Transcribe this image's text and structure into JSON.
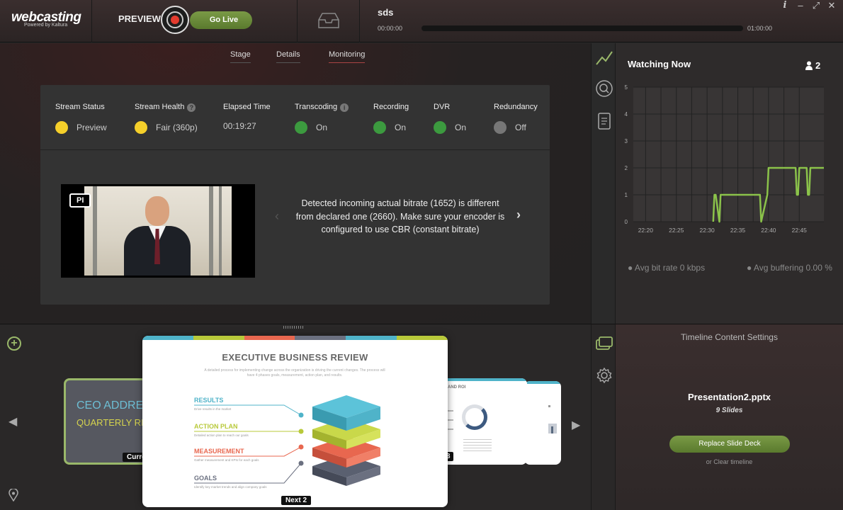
{
  "app": {
    "logo": "webcasting",
    "logo_sub": "Powered by Kaltura"
  },
  "header": {
    "mode_label": "PREVIEW",
    "go_live_label": "Go Live",
    "stream_title": "sds",
    "time_start": "00:00:00",
    "time_end": "01:00:00",
    "window_controls": [
      "i",
      "–",
      "⤢",
      "✕"
    ]
  },
  "tabs": [
    {
      "label": "Stage",
      "active": false
    },
    {
      "label": "Details",
      "active": false
    },
    {
      "label": "Monitoring",
      "active": true
    }
  ],
  "status": [
    {
      "label": "Stream Status",
      "value": "Preview",
      "color": "#f5cf2a",
      "help": false
    },
    {
      "label": "Stream Health",
      "value": "Fair (360p)",
      "color": "#f5cf2a",
      "help": true
    },
    {
      "label": "Elapsed Time",
      "value": "00:19:27",
      "color": "",
      "help": false
    },
    {
      "label": "Transcoding",
      "value": "On",
      "color": "#3c9a3f",
      "help": true
    },
    {
      "label": "Recording",
      "value": "On",
      "color": "#3c9a3f",
      "help": false
    },
    {
      "label": "DVR",
      "value": "On",
      "color": "#3c9a3f",
      "help": false
    },
    {
      "label": "Redundancy",
      "value": "Off",
      "color": "#777777",
      "help": false
    }
  ],
  "preview_badge": "PI",
  "alert_message": "Detected incoming actual bitrate (1652) is different from declared one (2660). Make sure your encoder is configured to use CBR (constant bitrate)",
  "watching": {
    "title": "Watching Now",
    "count": "2",
    "avg_bitrate": "● Avg bit rate 0 kbps",
    "avg_buffering": "● Avg buffering 0.00 %"
  },
  "chart_data": {
    "type": "line",
    "title": "Watching Now",
    "xlabel": "",
    "ylabel": "",
    "x_ticks": [
      "22:20",
      "22:25",
      "22:30",
      "22:35",
      "22:40",
      "22:45"
    ],
    "y_ticks": [
      0,
      1,
      2,
      3,
      4,
      5
    ],
    "ylim": [
      0,
      5
    ],
    "xlim": [
      "22:18",
      "22:49"
    ],
    "grid": true,
    "color": "#8bc34a",
    "series": [
      {
        "x": [
          "22:31.0",
          "22:31.2",
          "22:31.4",
          "22:32.0",
          "22:32.2",
          "22:38.6",
          "22:38.8",
          "22:39.8",
          "22:40.0",
          "22:44.4",
          "22:44.6",
          "22:44.8",
          "22:45.0",
          "22:46.2",
          "22:46.4",
          "22:46.6",
          "22:46.8",
          "22:49.0"
        ],
        "values": [
          0,
          1,
          1,
          0,
          1,
          1,
          0,
          1,
          2,
          2,
          1,
          1,
          2,
          2,
          1,
          1,
          2,
          2
        ]
      }
    ]
  },
  "slides": {
    "ceo_line1": "CEO ADDRE",
    "ceo_line2": "QUARTERLY RI",
    "current_badge": "Curre",
    "main_title": "EXECUTIVE BUSINESS REVIEW",
    "main_subtitle": "A detailed process for implementing change across the organization is driving the current changes. The process will have 4 phases goals, measurement, action plan, and results.",
    "items": [
      {
        "label": "RESULTS",
        "desc": "Drive results in the market",
        "color": "#4fb3c9"
      },
      {
        "label": "ACTION PLAN",
        "desc": "Detailed action plan to reach our goals",
        "color": "#b8c93a"
      },
      {
        "label": "MEASUREMENT",
        "desc": "Gather measurement and KPIs for each goals",
        "color": "#e8674f"
      },
      {
        "label": "GOALS",
        "desc": "Identify key market trends and align company goals",
        "color": "#6b7080"
      }
    ],
    "next_badge": "Next 2",
    "third_badge": "3",
    "third_heading": "AND ROI"
  },
  "timeline": {
    "title": "Timeline Content Settings",
    "file": "Presentation2.pptx",
    "slides": "9 Slides",
    "replace_label": "Replace Slide Deck",
    "clear_label": "or Clear timeline"
  }
}
